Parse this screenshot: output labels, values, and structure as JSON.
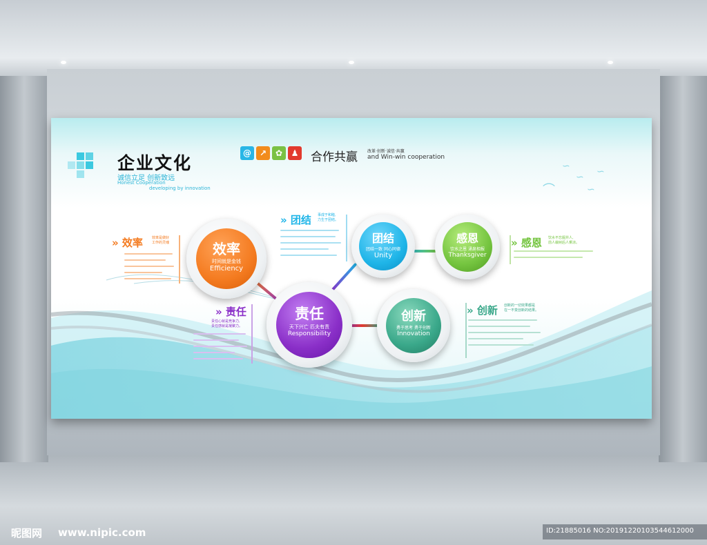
{
  "header": {
    "title": "企业文化",
    "sub_cn": "诚信立足  创新致远",
    "sub_en1": "Honest Cooperation",
    "sub_en2": "developing by innovation"
  },
  "slogan": {
    "badges": [
      "@",
      "↗",
      "✿",
      "♟"
    ],
    "badge_colors": [
      "#29b6e6",
      "#f28c1c",
      "#7ac143",
      "#e23a2e"
    ],
    "title": "合作共赢",
    "small": "改革·创新·诚信·共赢",
    "english": "and Win-win  cooperation"
  },
  "sections": {
    "efficiency": {
      "head": "效率",
      "note": "效率是做好\n工作的灵魂"
    },
    "unity": {
      "head": "团结",
      "note": "事成于和睦,\n力生于团结。"
    },
    "gratitude": {
      "head": "感恩",
      "note": "饮水不忘掘井人,\n前人栽树后人乘凉。"
    },
    "responsibility": {
      "head": "责任",
      "note": "责任心就是竞争力,\n责任感就是凝聚力。"
    },
    "innovation": {
      "head": "创新",
      "note": "创新的一切效果都是\n在一不变创新的结果。"
    }
  },
  "circles": {
    "efficiency": {
      "cn": "效率",
      "sub": "时间就是金钱",
      "en": "Efficiency",
      "color": "#f47b20"
    },
    "unity": {
      "cn": "团结",
      "sub": "团结一致  同心同德",
      "en": "Unity",
      "color": "#1fb5e8"
    },
    "gratitude": {
      "cn": "感恩",
      "sub": "饮水之恩  涌泉相报",
      "en": "Thanksgiver",
      "color": "#74c43f"
    },
    "responsibility": {
      "cn": "责任",
      "sub": "天下兴亡  匹夫有责",
      "en": "Responsibility",
      "color": "#8a2fc8"
    },
    "innovation": {
      "cn": "创新",
      "sub": "勇于思考  勇于创新",
      "en": "Innovation",
      "color": "#3aa88a"
    }
  },
  "footer": {
    "watermark": "昵图网",
    "url": "www.nipic.com",
    "id_text": "ID:21885016 NO:20191220103544612000"
  }
}
